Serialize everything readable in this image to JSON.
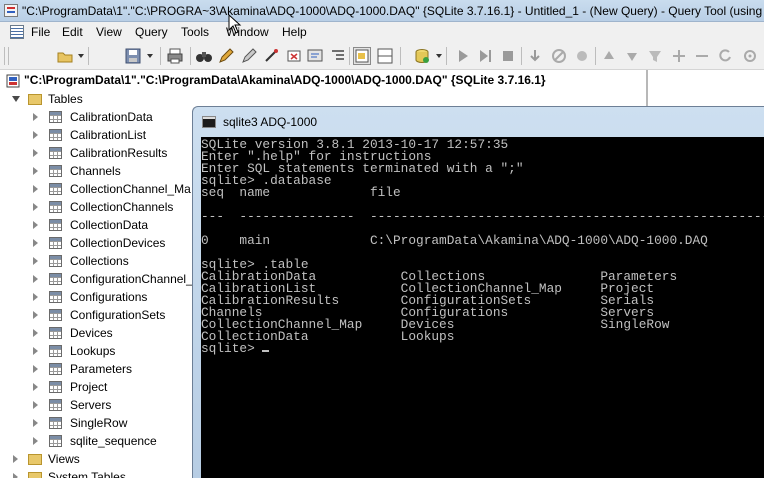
{
  "window": {
    "title": "\"C:\\ProgramData\\1\".\"C:\\PROGRA~3\\Akamina\\ADQ-1000\\ADQ-1000.DAQ\" {SQLite 3.7.16.1} - Untitled_1 - (New Query) - Query Tool (using A"
  },
  "menu": [
    "File",
    "Edit",
    "View",
    "Query",
    "Tools",
    "Window",
    "Help"
  ],
  "toolbar": {
    "icons": [
      "open-folder-icon",
      "save-icon",
      "print-icon",
      "binoculars-icon",
      "pencil-icon",
      "grid-view-icon",
      "split-view-icon",
      "cylinder-icon",
      "play-icon",
      "step-icon",
      "stop-icon",
      "step-into-icon",
      "clear-icon",
      "breakpoint-icon",
      "move-up-icon",
      "move-down-icon",
      "filter-icon",
      "expand-icon"
    ]
  },
  "tree": {
    "database_label": "\"C:\\ProgramData\\1\".\"C:\\ProgramData\\Akamina\\ADQ-1000\\ADQ-1000.DAQ\" {SQLite 3.7.16.1}",
    "tables_label": "Tables",
    "tables": [
      "CalibrationData",
      "CalibrationList",
      "CalibrationResults",
      "Channels",
      "CollectionChannel_Ma",
      "CollectionChannels",
      "CollectionData",
      "CollectionDevices",
      "Collections",
      "ConfigurationChannel_",
      "Configurations",
      "ConfigurationSets",
      "Devices",
      "Lookups",
      "Parameters",
      "Project",
      "Servers",
      "SingleRow",
      "sqlite_sequence"
    ],
    "views_label": "Views",
    "system_tables_label": "System Tables"
  },
  "console": {
    "title": "sqlite3 ADQ-1000",
    "lines": [
      "SQLite version 3.8.1 2013-10-17 12:57:35",
      "Enter \".help\" for instructions",
      "Enter SQL statements terminated with a \";\"",
      "sqlite> .database",
      "seq  name             file",
      "",
      "---  ---------------  ----------------------------------------------------------",
      "",
      "0    main             C:\\ProgramData\\Akamina\\ADQ-1000\\ADQ-1000.DAQ",
      "",
      "sqlite> .table",
      "CalibrationData           Collections               Parameters",
      "CalibrationList           CollectionChannel_Map     Project",
      "CalibrationResults        ConfigurationSets         Serials",
      "Channels                  Configurations            Servers",
      "CollectionChannel_Map     Devices                   SingleRow",
      "CollectionData            Lookups",
      "sqlite> "
    ]
  },
  "colors": {
    "titlebar": "#c0d5ea",
    "console_bg": "#000000",
    "console_text": "#c0c0c0"
  }
}
